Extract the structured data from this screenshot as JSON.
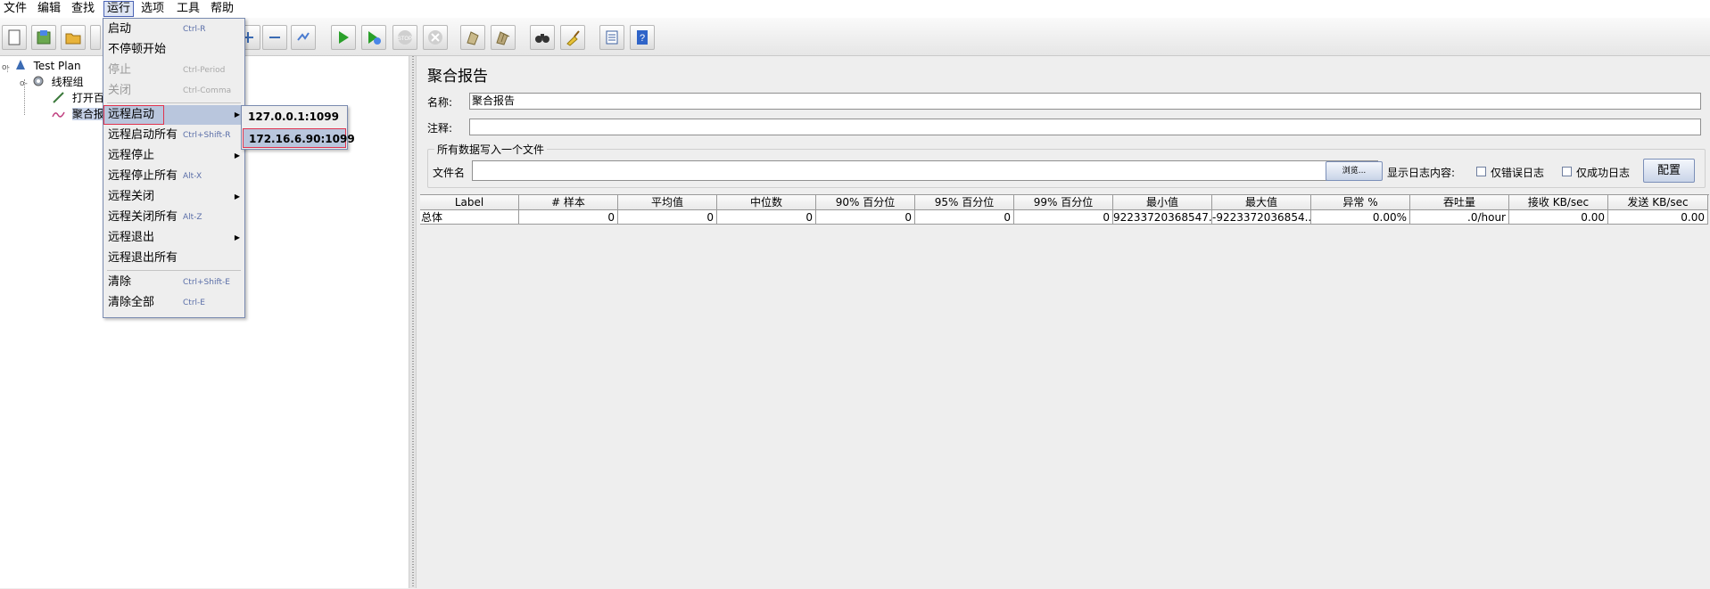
{
  "menubar": [
    "文件",
    "编辑",
    "查找",
    "运行",
    "选项",
    "工具",
    "帮助"
  ],
  "run_menu": {
    "items": [
      {
        "label": "启动",
        "accel": "Ctrl-R",
        "enabled": true
      },
      {
        "label": "不停顿开始",
        "accel": "",
        "enabled": true
      },
      {
        "label": "停止",
        "accel": "Ctrl-Period",
        "enabled": false
      },
      {
        "label": "关闭",
        "accel": "Ctrl-Comma",
        "enabled": false
      },
      {
        "label": "远程启动",
        "accel": "",
        "submenu": true,
        "enabled": true
      },
      {
        "label": "远程启动所有",
        "accel": "Ctrl+Shift-R",
        "enabled": true
      },
      {
        "label": "远程停止",
        "accel": "",
        "submenu": true,
        "enabled": true
      },
      {
        "label": "远程停止所有",
        "accel": "Alt-X",
        "enabled": true
      },
      {
        "label": "远程关闭",
        "accel": "",
        "submenu": true,
        "enabled": true
      },
      {
        "label": "远程关闭所有",
        "accel": "Alt-Z",
        "enabled": true
      },
      {
        "label": "远程退出",
        "accel": "",
        "submenu": true,
        "enabled": true
      },
      {
        "label": "远程退出所有",
        "accel": "",
        "enabled": true
      },
      {
        "label": "清除",
        "accel": "Ctrl+Shift-E",
        "enabled": true
      },
      {
        "label": "清除全部",
        "accel": "Ctrl-E",
        "enabled": true
      }
    ],
    "remote_start_submenu": [
      "127.0.0.1:1099",
      "172.16.6.90:1099"
    ]
  },
  "tree": {
    "root": "Test Plan",
    "thread_group": "线程组",
    "child1": "打开百",
    "child2": "聚合报"
  },
  "panel": {
    "title": "聚合报告",
    "name_label": "名称:",
    "name_value": "聚合报告",
    "comment_label": "注释:",
    "comment_value": "",
    "fieldset_legend": "所有数据写入一个文件",
    "filename_label": "文件名",
    "filename_value": "",
    "browse_button": "浏览...",
    "log_label": "显示日志内容:",
    "errors_only": "仅错误日志",
    "success_only": "仅成功日志",
    "config_button": "配置"
  },
  "table": {
    "headers": [
      "Label",
      "# 样本",
      "平均值",
      "中位数",
      "90% 百分位",
      "95% 百分位",
      "99% 百分位",
      "最小值",
      "最大值",
      "异常 %",
      "吞吐量",
      "接收 KB/sec",
      "发送 KB/sec"
    ],
    "rows": [
      [
        "总体",
        "0",
        "0",
        "0",
        "0",
        "0",
        "0",
        "92233720368547...",
        "-9223372036854...",
        "0.00%",
        ".0/hour",
        "0.00",
        "0.00"
      ]
    ]
  }
}
